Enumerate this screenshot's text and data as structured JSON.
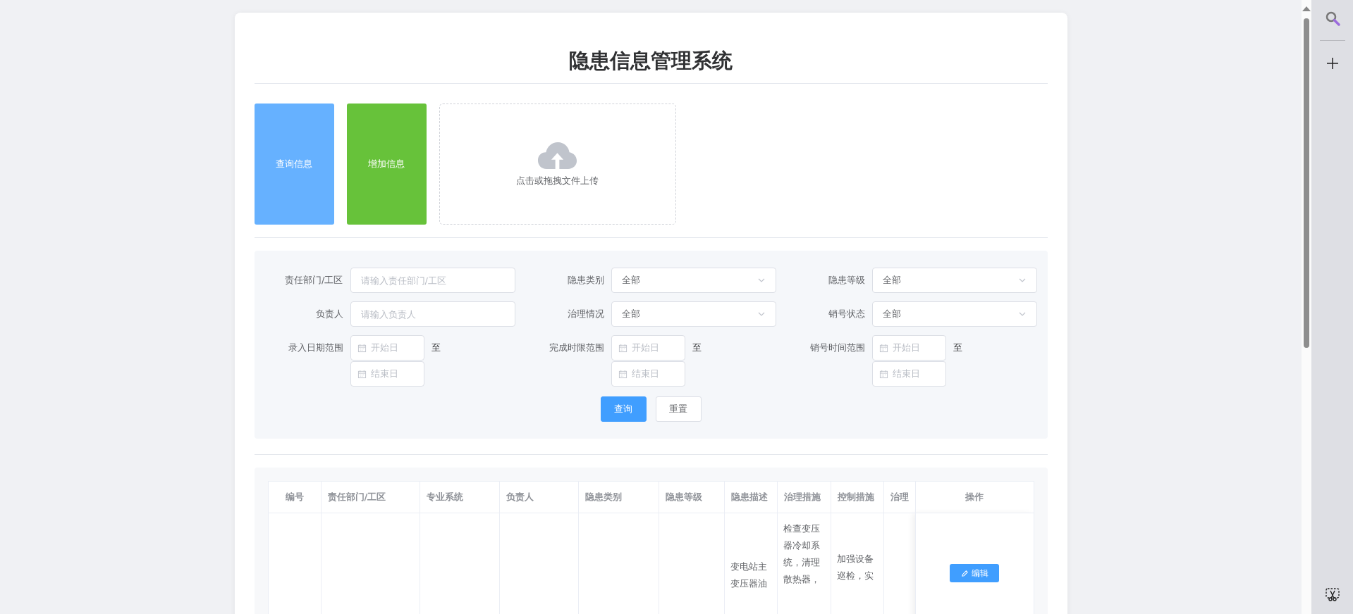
{
  "title": "隐患信息管理系统",
  "actions": [
    {
      "kind": "button",
      "label": "查询信息",
      "color": "#66b1ff"
    },
    {
      "kind": "button",
      "label": "增加信息",
      "color": "#67c23a"
    },
    {
      "kind": "upload",
      "label": "点击或拖拽文件上传"
    }
  ],
  "filters": [
    {
      "kind": "text",
      "label": "责任部门/工区",
      "placeholder": "请输入责任部门/工区"
    },
    {
      "kind": "select",
      "label": "隐患类别",
      "value": "全部"
    },
    {
      "kind": "select",
      "label": "隐患等级",
      "value": "全部"
    },
    {
      "kind": "text",
      "label": "负责人",
      "placeholder": "请输入负责人"
    },
    {
      "kind": "select",
      "label": "治理情况",
      "value": "全部"
    },
    {
      "kind": "select",
      "label": "销号状态",
      "value": "全部"
    },
    {
      "kind": "daterange",
      "label": "录入日期范围",
      "start_placeholder": "开始日",
      "end_placeholder": "结束日",
      "separator": "至"
    },
    {
      "kind": "daterange",
      "label": "完成时限范围",
      "start_placeholder": "开始日",
      "end_placeholder": "结束日",
      "separator": "至"
    },
    {
      "kind": "daterange",
      "label": "销号时间范围",
      "start_placeholder": "开始日",
      "end_placeholder": "结束日",
      "separator": "至"
    }
  ],
  "buttons": [
    {
      "kind": "primary",
      "label": "查询"
    },
    {
      "kind": "default",
      "label": "重置"
    }
  ],
  "table": {
    "columns": [
      "编号",
      "责任部门/工区",
      "专业系统",
      "负责人",
      "隐患类别",
      "隐患等级",
      "隐患描述",
      "治理措施",
      "控制措施",
      "治理",
      "操作"
    ],
    "rows": [
      {
        "description": "变电站主变压器油",
        "treatment": "检查变压器冷却系统，清理散热器，",
        "control": "加强设备巡检，实",
        "action": "编辑"
      }
    ]
  }
}
